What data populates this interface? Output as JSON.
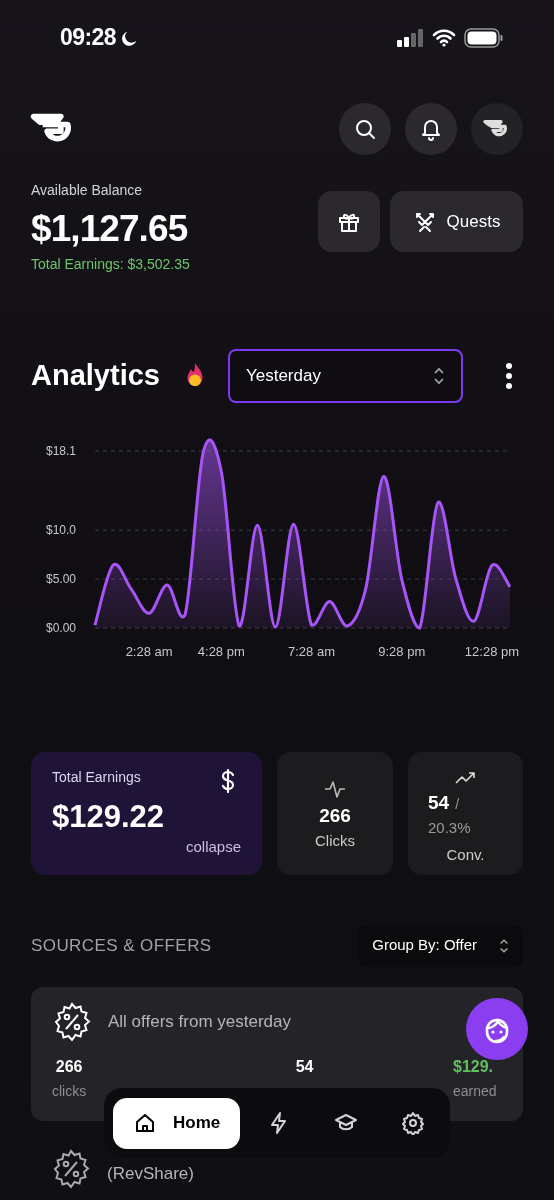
{
  "status_bar": {
    "time": "09:28"
  },
  "balance": {
    "label": "Available Balance",
    "amount": "$1,127.65",
    "total_earnings": "Total Earnings: $3,502.35"
  },
  "quests_button": {
    "label": "Quests"
  },
  "analytics": {
    "title": "Analytics",
    "period": "Yesterday",
    "chart_data": {
      "type": "area",
      "categories": [
        null,
        null,
        null,
        "2:28 am",
        null,
        null,
        null,
        "4:28 pm",
        null,
        null,
        null,
        null,
        "7:28 am",
        null,
        null,
        null,
        null,
        "9:28 pm",
        null,
        null,
        null,
        null,
        "12:28 pm",
        null
      ],
      "series": [
        {
          "color": "#a855f7",
          "values": [
            0.3,
            6.4,
            4.0,
            1.5,
            4.4,
            1.4,
            18.0,
            16.0,
            0.2,
            10.5,
            0.1,
            10.6,
            0.3,
            2.7,
            0.2,
            4.0,
            15.5,
            5.0,
            0,
            12.8,
            5.0,
            0.7,
            6.4,
            4.2
          ]
        }
      ],
      "ylim": [
        0,
        18.1
      ],
      "yticks": [
        {
          "value": 0,
          "label": "$0.00"
        },
        {
          "value": 5,
          "label": "$5.00"
        },
        {
          "value": 10,
          "label": "$10.0"
        },
        {
          "value": 18.1,
          "label": "$18.1"
        }
      ]
    }
  },
  "stats": {
    "earnings": {
      "label": "Total Earnings",
      "value": "$129.22",
      "action": "collapse"
    },
    "clicks": {
      "value": "266",
      "label": "Clicks"
    },
    "conversions": {
      "value": "54",
      "separator": "/",
      "rate": "20.3%",
      "label": "Conv."
    }
  },
  "sources": {
    "title": "SOURCES & OFFERS",
    "group_by": "Group By: Offer",
    "summary": {
      "title": "All offers from yesterday",
      "clicks": "266",
      "clicks_label": "clicks",
      "conversions": "54",
      "earned": "$129.",
      "earned_label": "earned"
    },
    "offers": [
      {
        "title": "(RevShare)"
      }
    ]
  },
  "nav": [
    {
      "kind": "home",
      "label": "Home",
      "selected": true
    },
    {
      "kind": "bolt",
      "selected": false
    },
    {
      "kind": "courses",
      "selected": false
    },
    {
      "kind": "settings",
      "selected": false
    }
  ]
}
